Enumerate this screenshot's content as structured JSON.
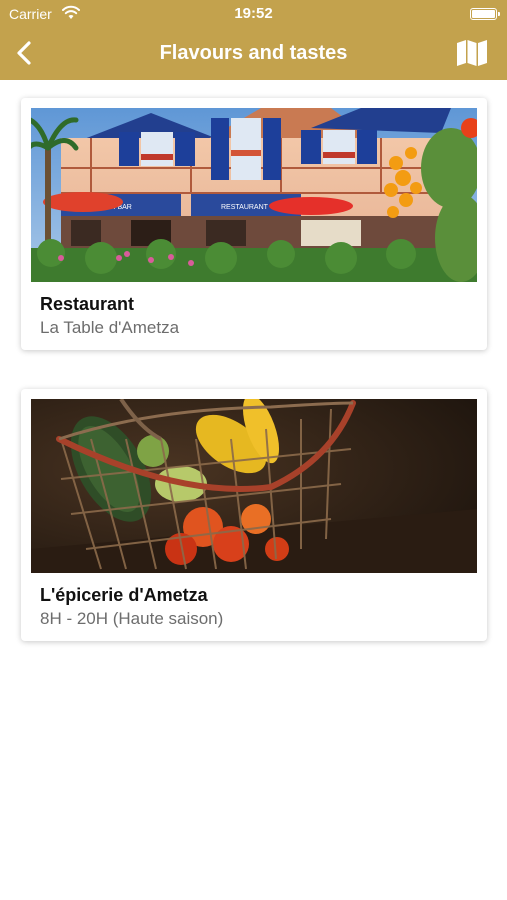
{
  "status_bar": {
    "carrier": "Carrier",
    "time": "19:52",
    "battery_level": 1.0
  },
  "nav": {
    "title": "Flavours and tastes",
    "back_icon": "chevron-left-icon",
    "map_icon": "map-icon"
  },
  "colors": {
    "header": "#c3a24d",
    "title_text": "#111111",
    "subtitle_text": "#6d6d6d"
  },
  "places": [
    {
      "title": "Restaurant",
      "subtitle": "La Table d'Ametza",
      "image": "restaurant-photo",
      "image_signs": [
        "SNACK-BAR",
        "RESTAURANT"
      ]
    },
    {
      "title": "L'épicerie d'Ametza",
      "subtitle": "8H - 20H (Haute saison)",
      "image": "vegetable-basket-photo"
    }
  ]
}
